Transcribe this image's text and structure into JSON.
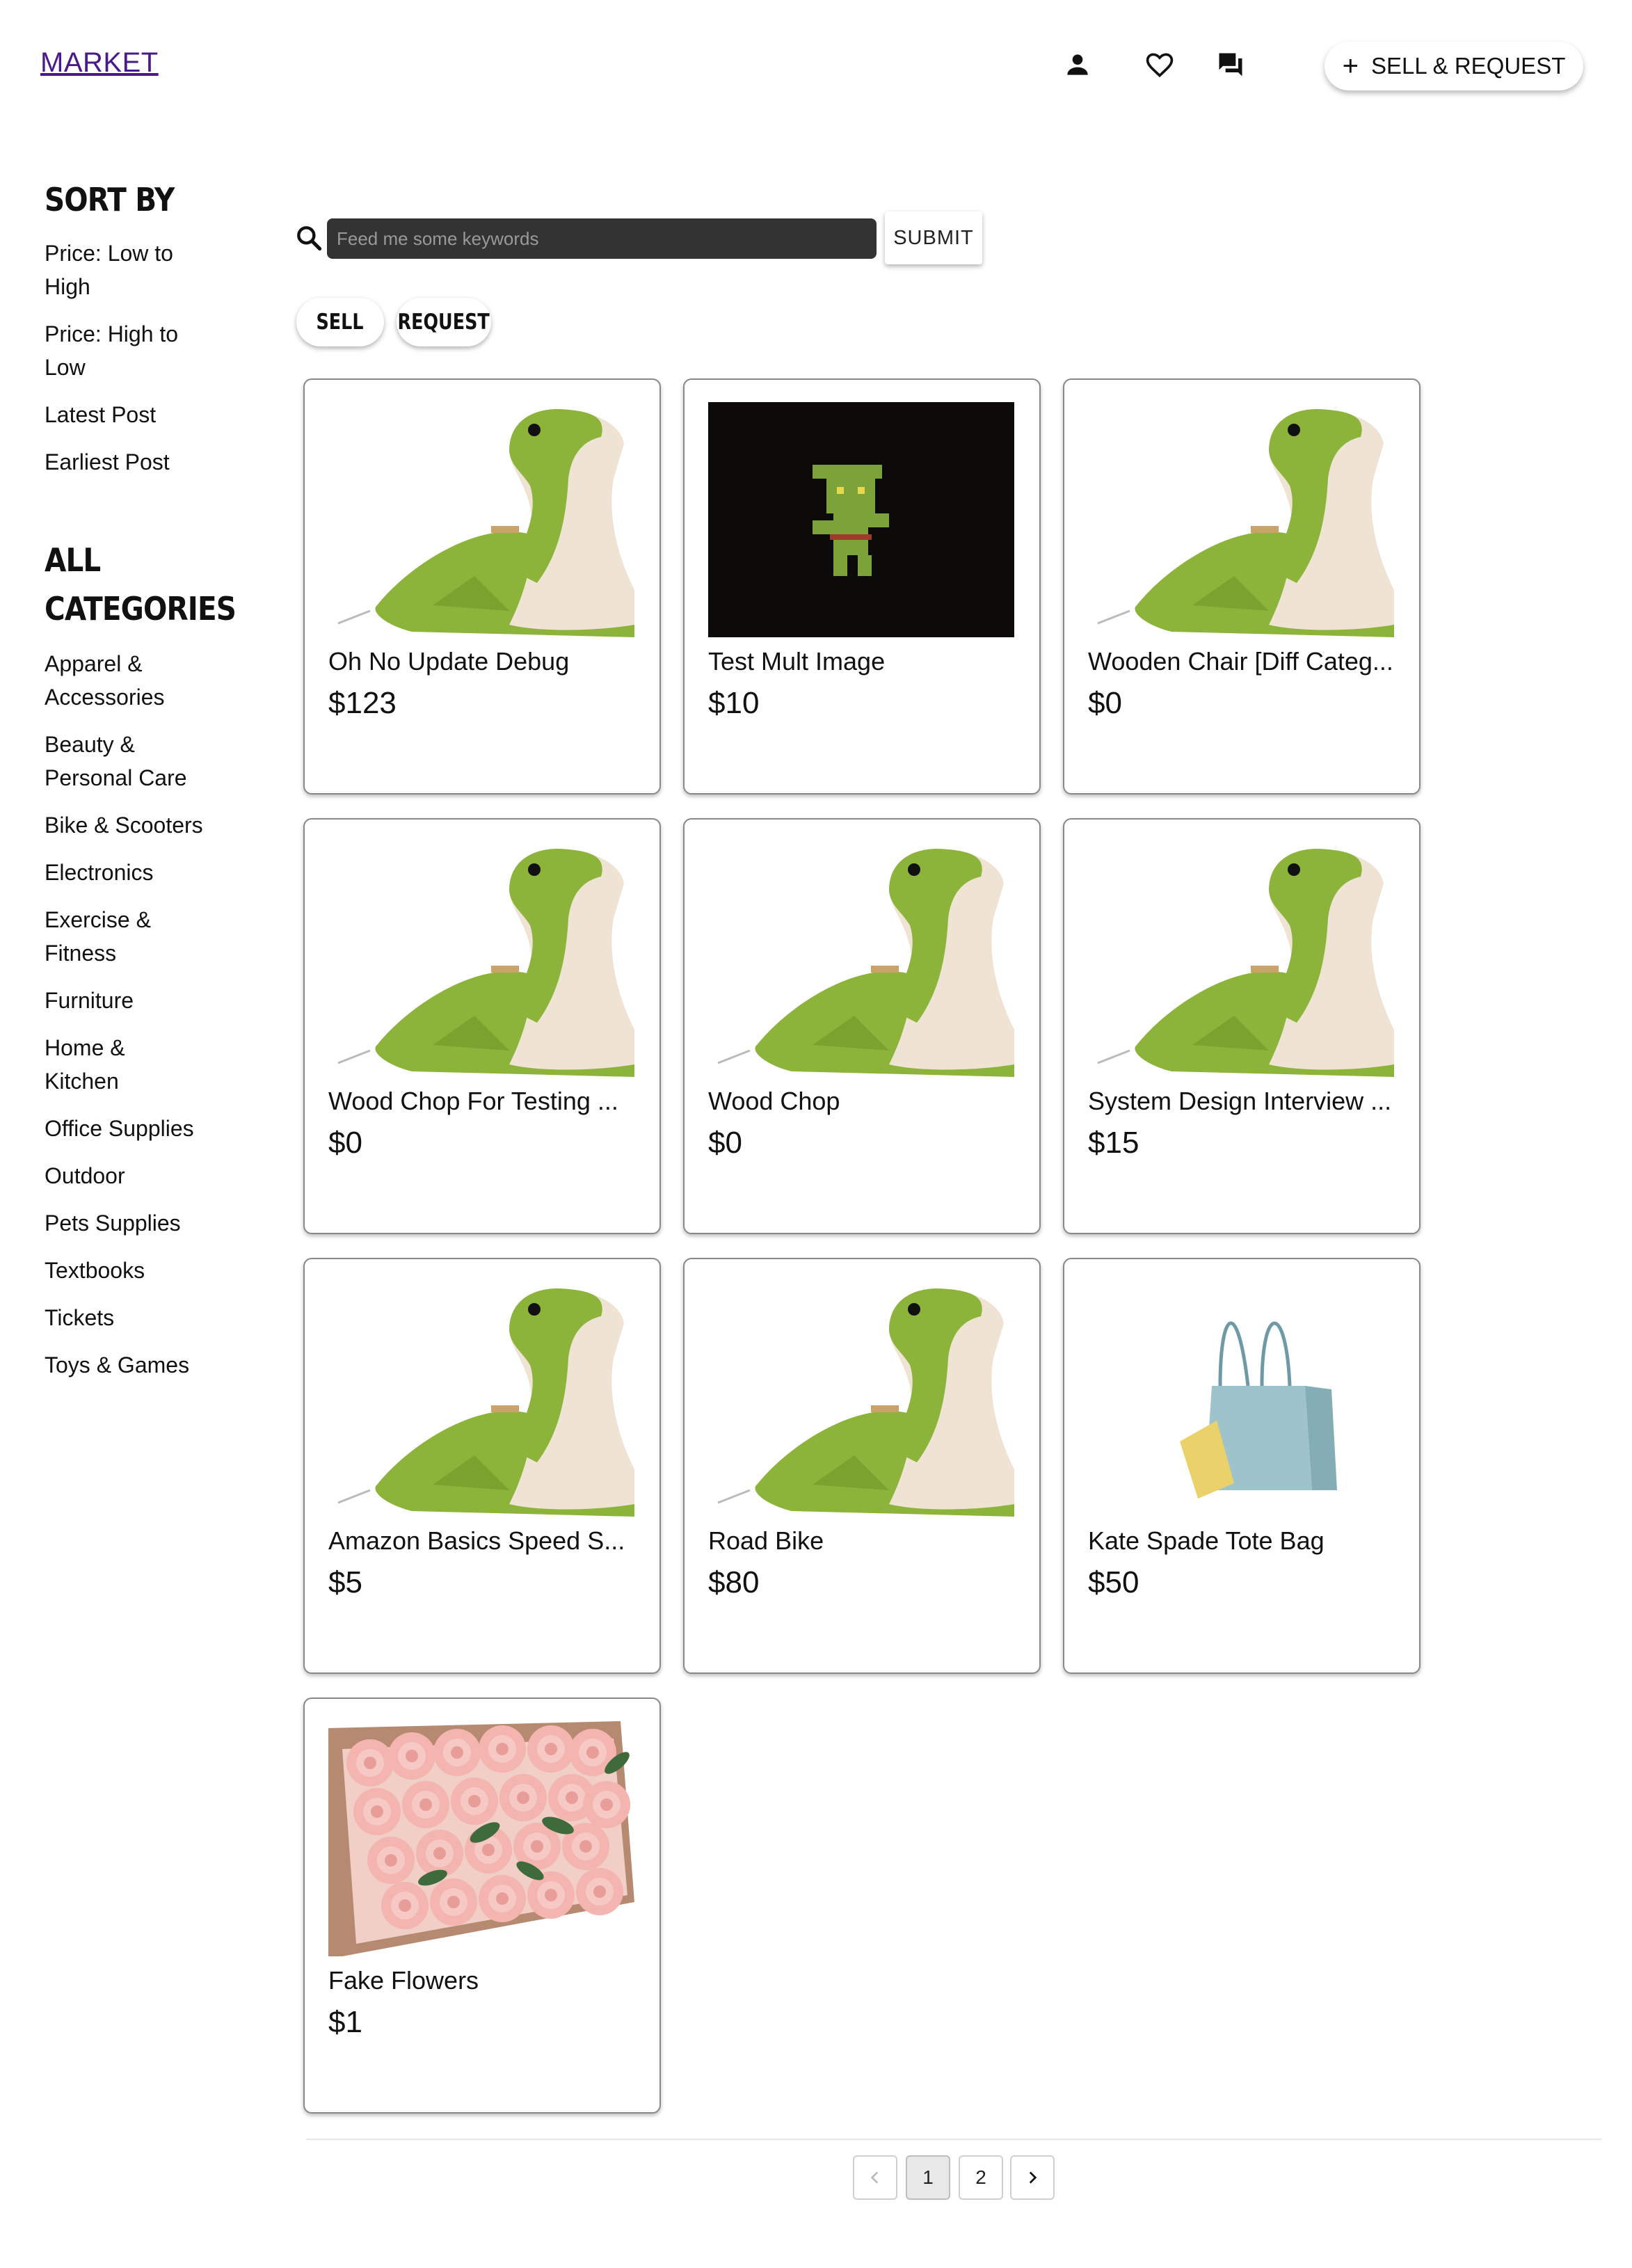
{
  "header": {
    "logo": "MARKET",
    "icons": [
      "person-icon",
      "heart-icon",
      "chat-icon"
    ],
    "sell_request_label": "SELL & REQUEST"
  },
  "sidebar": {
    "sort_heading": "SORT BY",
    "sort_options": [
      "Price: Low to High",
      "Price: High to Low",
      "Latest Post",
      "Earliest Post"
    ],
    "categories_heading": "ALL CATEGORIES",
    "categories": [
      "Apparel & Accessories",
      "Beauty & Personal Care",
      "Bike & Scooters",
      "Electronics",
      "Exercise & Fitness",
      "Furniture",
      "Home & Kitchen",
      "Office Supplies",
      "Outdoor",
      "Pets Supplies",
      "Textbooks",
      "Tickets",
      "Toys & Games"
    ]
  },
  "search": {
    "placeholder": "Feed me some keywords",
    "value": "",
    "submit_label": "SUBMIT"
  },
  "filters": {
    "sell_label": "SELL",
    "request_label": "REQUEST"
  },
  "listings": [
    {
      "title": "Oh No Update Debug",
      "price": "$123",
      "image": "green-plush-toy"
    },
    {
      "title": "Test Mult Image",
      "price": "$10",
      "image": "pixel-goblin"
    },
    {
      "title": "Wooden Chair [Diff Categ...",
      "price": "$0",
      "image": "green-plush-toy"
    },
    {
      "title": "Wood Chop For Testing ...",
      "price": "$0",
      "image": "green-plush-toy"
    },
    {
      "title": "Wood Chop",
      "price": "$0",
      "image": "green-plush-toy"
    },
    {
      "title": "System Design Interview ...",
      "price": "$15",
      "image": "green-plush-toy"
    },
    {
      "title": "Amazon Basics Speed S...",
      "price": "$5",
      "image": "green-plush-toy"
    },
    {
      "title": "Road Bike",
      "price": "$80",
      "image": "green-plush-toy"
    },
    {
      "title": "Kate Spade Tote Bag",
      "price": "$50",
      "image": "tote-bag"
    },
    {
      "title": "Fake Flowers",
      "price": "$1",
      "image": "pink-roses"
    }
  ],
  "pagination": {
    "pages": [
      "1",
      "2"
    ],
    "current": "1"
  },
  "colors": {
    "logo": "#4a1a8a",
    "search_bg": "#333333",
    "plush_green": "#8db43a",
    "plush_cream": "#efe3d4"
  }
}
